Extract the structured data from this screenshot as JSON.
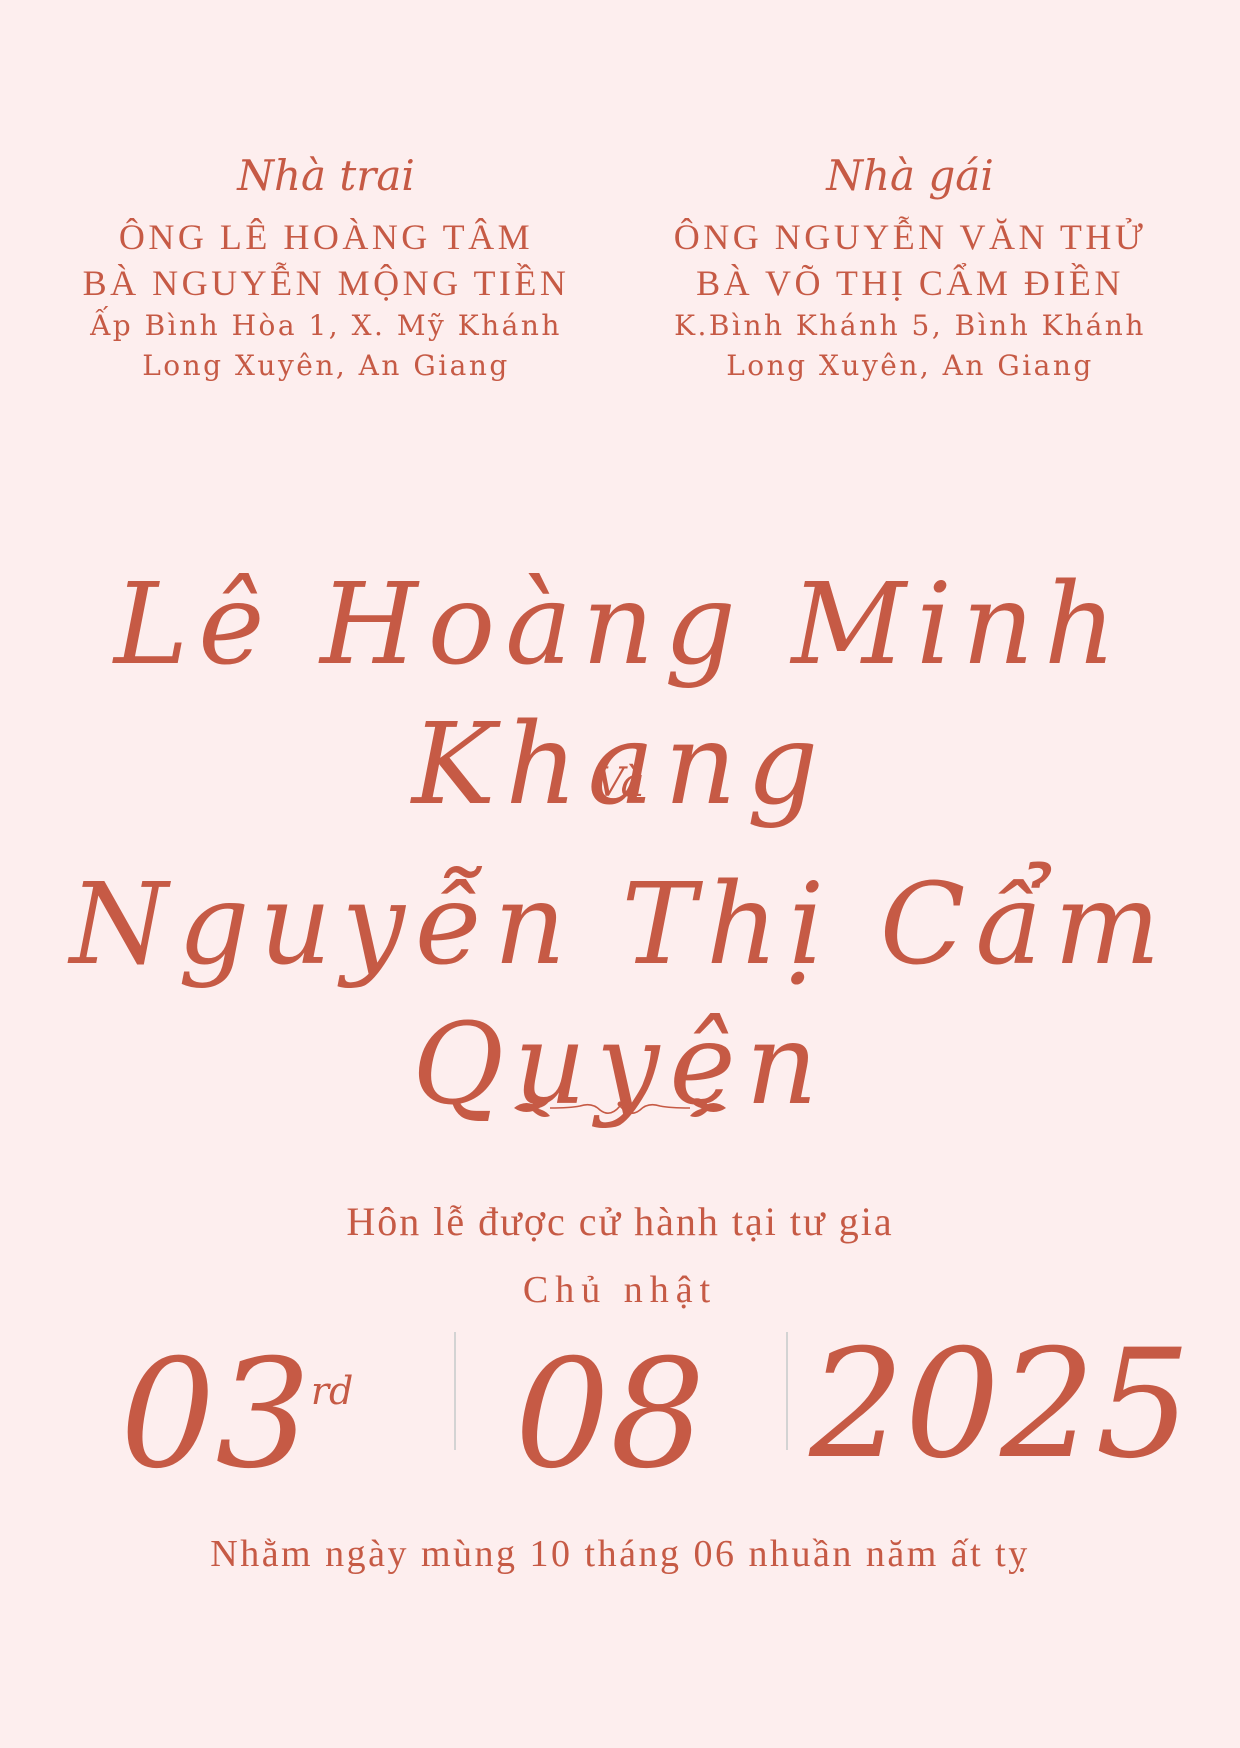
{
  "groom_family": {
    "heading": "Nhà trai",
    "father": "ÔNG LÊ HOÀNG TÂM",
    "mother": "BÀ NGUYỄN MỘNG TIỀN",
    "address_line1": "Ấp Bình Hòa 1, X. Mỹ Khánh",
    "address_line2": "Long Xuyên, An Giang"
  },
  "bride_family": {
    "heading": "Nhà gái",
    "father": "ÔNG NGUYỄN VĂN THỬ",
    "mother": "BÀ VÕ THỊ CẨM ĐIỀN",
    "address_line1": "K.Bình Khánh 5, Bình Khánh",
    "address_line2": "Long Xuyên, An Giang"
  },
  "couple": {
    "groom": "Lê Hoàng Minh Khang",
    "and": "Và",
    "bride": "Nguyễn Thị Cẩm Quyên"
  },
  "event": {
    "ceremony": "Hôn lễ được cử hành tại tư gia",
    "weekday": "Chủ nhật",
    "day": "03",
    "day_suffix": "rd",
    "month": "08",
    "year": "2025",
    "lunar_date": "Nhằm ngày mùng 10 tháng 06 nhuần năm ất tỵ"
  },
  "colors": {
    "background": "#fdeeee",
    "accent": "#c65a45",
    "divider": "#d3d3d3"
  }
}
